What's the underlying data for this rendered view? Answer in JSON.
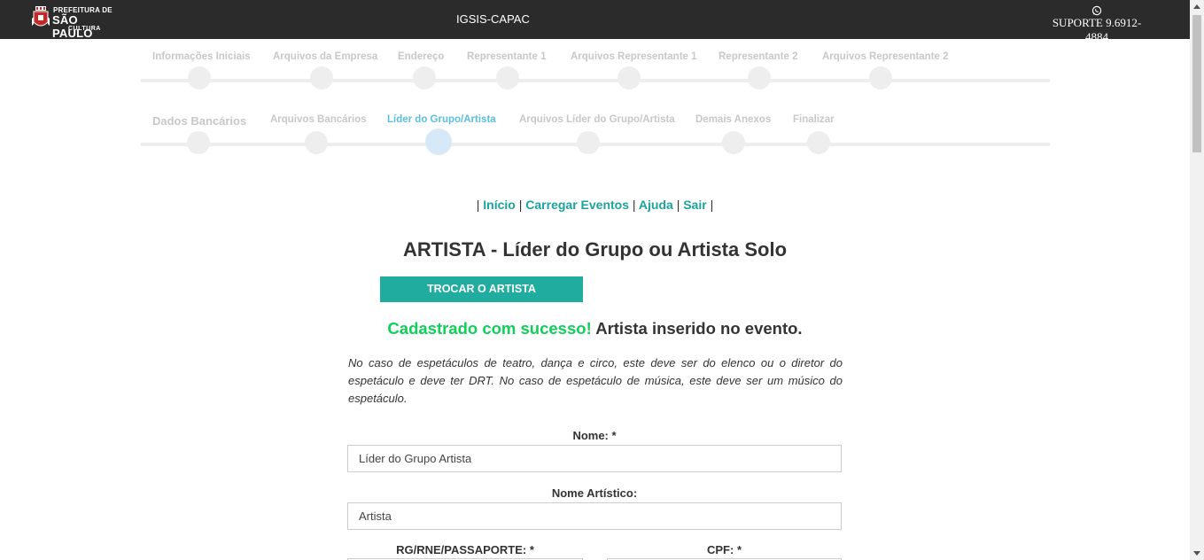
{
  "header": {
    "logo": {
      "line1": "PREFEITURA DE",
      "line2": "SÃO PAULO",
      "line3": "CULTURA"
    },
    "app_title": "IGSIS-CAPAC",
    "support": {
      "icon": "whatsapp-icon",
      "text": "SUPORTE 9.6912-4884"
    }
  },
  "steps_row1": [
    {
      "label": "Informações Iniciais"
    },
    {
      "label": "Arquivos da Empresa"
    },
    {
      "label": "Endereço"
    },
    {
      "label": "Representante 1"
    },
    {
      "label": "Arquivos Representante 1"
    },
    {
      "label": "Representante 2"
    },
    {
      "label": "Arquivos Representante 2"
    }
  ],
  "steps_row2": [
    {
      "label": "Dados Bancários"
    },
    {
      "label": "Arquivos Bancários"
    },
    {
      "label": "Líder do Grupo/Artista",
      "active": true
    },
    {
      "label": "Arquivos Líder do Grupo/Artista"
    },
    {
      "label": "Demais Anexos"
    },
    {
      "label": "Finalizar"
    }
  ],
  "nav": {
    "inicio": "Início",
    "carregar": "Carregar Eventos",
    "ajuda": "Ajuda",
    "sair": "Sair",
    "sep": "|"
  },
  "page_title": "ARTISTA - Líder do Grupo ou Artista Solo",
  "change_button": "TROCAR O ARTISTA",
  "message": {
    "success": "Cadastrado com sucesso!",
    "detail": "Artista inserido no evento."
  },
  "note": "No caso de espetáculos de teatro, dança e circo, este deve ser do elenco ou o diretor do espetáculo e deve ter DRT. No caso de espetáculo de música, este deve ser um músico do espetáculo.",
  "form": {
    "nome_label": "Nome: *",
    "nome_value": "Líder do Grupo Artista",
    "nome_artistico_label": "Nome Artístico:",
    "nome_artistico_value": "Artista",
    "rg_label": "RG/RNE/PASSAPORTE: *",
    "cpf_label": "CPF: *"
  },
  "colors": {
    "accent": "#20ada0",
    "link": "#1ba39c",
    "success": "#0fd15a",
    "active_step": "#5bc0de",
    "topbar": "#2b2b2b"
  }
}
